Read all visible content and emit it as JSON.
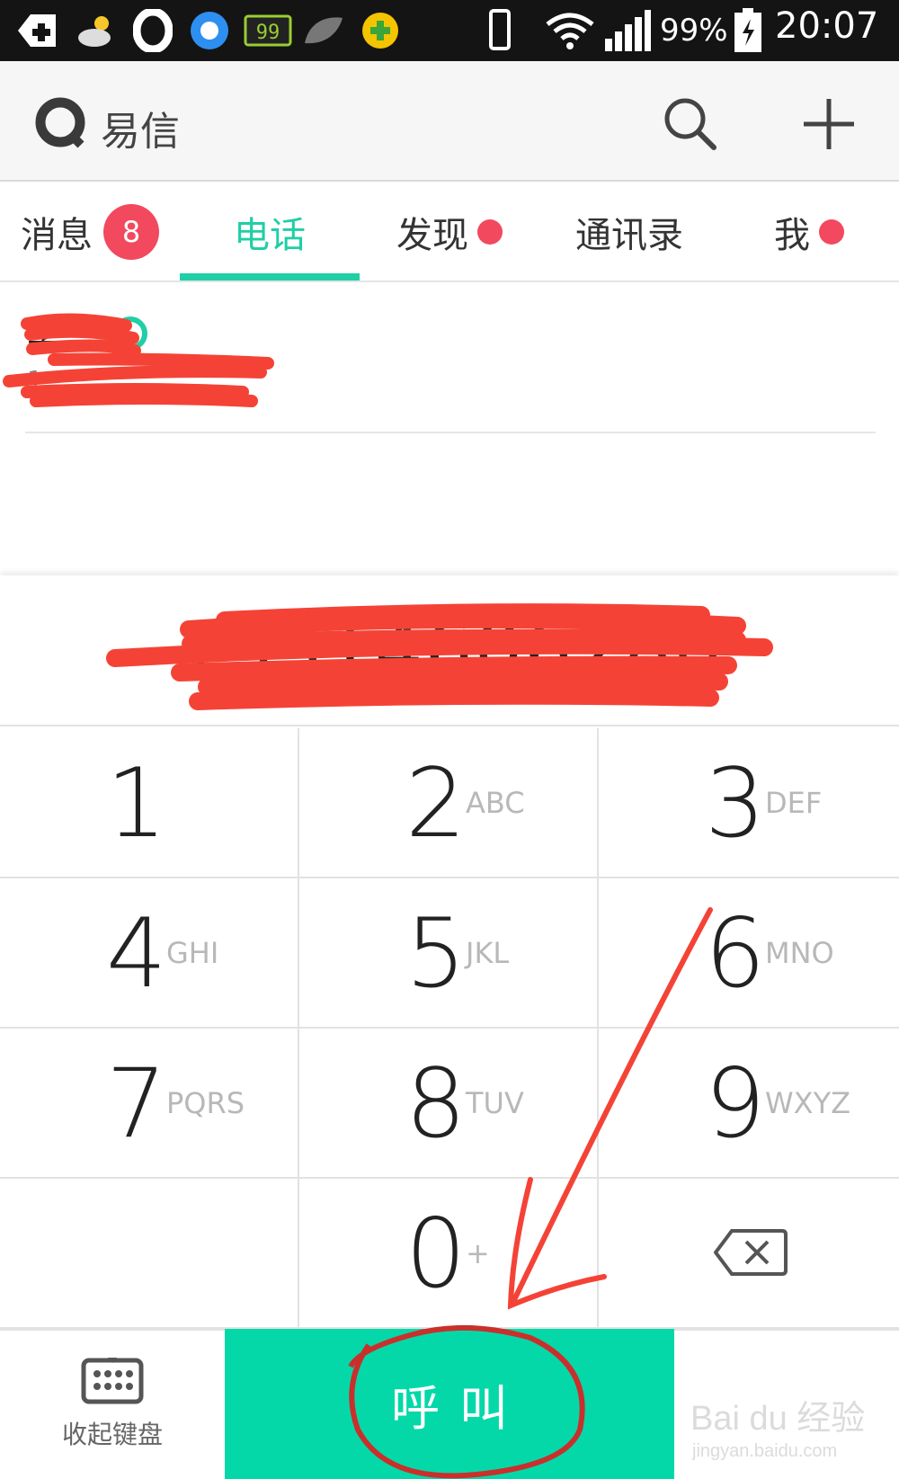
{
  "status_bar": {
    "battery_percent": "99%",
    "time": "20:07",
    "icons": [
      "add-icon",
      "weather-icon",
      "opera-icon",
      "browser-icon",
      "battery-game-icon",
      "leaf-icon",
      "plus-circle-icon",
      "vibrate-icon",
      "wifi-icon",
      "signal-icon",
      "battery-charging-icon"
    ]
  },
  "header": {
    "app_name": "易信",
    "logo_icon": "yixin-logo-icon",
    "search_icon": "search-icon",
    "add_icon": "add-icon"
  },
  "tabs": [
    {
      "label": "消息",
      "badge": "8",
      "active": false
    },
    {
      "label": "电话",
      "active": true
    },
    {
      "label": "发现",
      "dot": true,
      "active": false
    },
    {
      "label": "通讯录",
      "active": false
    },
    {
      "label": "我",
      "dot": true,
      "active": false
    }
  ],
  "recent_call": {
    "name": "李…",
    "number": "1…"
  },
  "dialer": {
    "display_number": "13514606280",
    "keys": [
      {
        "digit": "1",
        "letters": ""
      },
      {
        "digit": "2",
        "letters": "ABC"
      },
      {
        "digit": "3",
        "letters": "DEF"
      },
      {
        "digit": "4",
        "letters": "GHI"
      },
      {
        "digit": "5",
        "letters": "JKL"
      },
      {
        "digit": "6",
        "letters": "MNO"
      },
      {
        "digit": "7",
        "letters": "PQRS"
      },
      {
        "digit": "8",
        "letters": "TUV"
      },
      {
        "digit": "9",
        "letters": "WXYZ"
      },
      {
        "digit": "0",
        "letters": "+"
      }
    ],
    "backspace_icon": "backspace-icon"
  },
  "bottom_bar": {
    "collapse_label": "收起键盘",
    "collapse_icon": "keyboard-icon",
    "call_label": "呼叫"
  },
  "watermark": {
    "brand": "Bai du 经验",
    "url": "jingyan.baidu.com"
  },
  "colors": {
    "accent": "#1fcfa6",
    "call_button": "#04d8a9",
    "badge": "#f2495f",
    "status_bar": "#141414",
    "header_bg": "#f6f6f6",
    "annotation_red": "#f44336"
  }
}
